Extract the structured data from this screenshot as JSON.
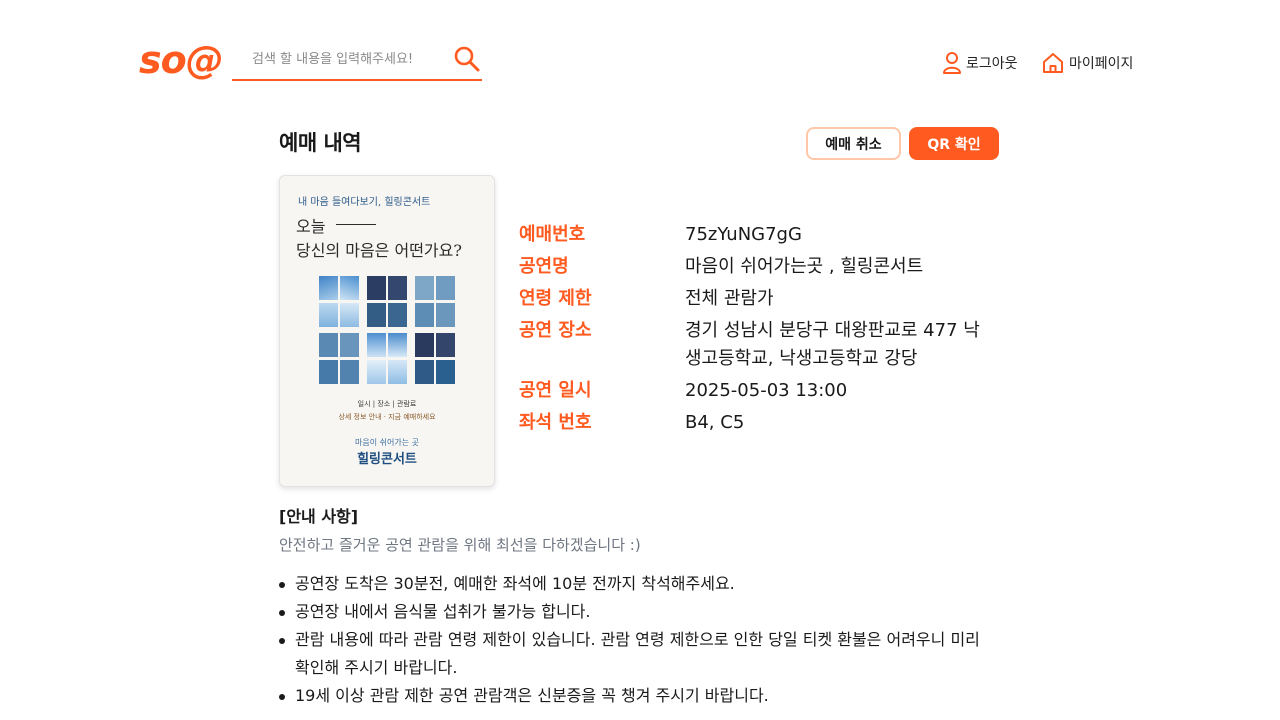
{
  "header": {
    "logo": "so@",
    "search_placeholder": "검색 할 내용을 입력해주세요!",
    "logout_label": "로그아웃",
    "mypage_label": "마이페이지"
  },
  "page": {
    "title": "예매 내역",
    "cancel_button": "예매 취소",
    "qr_button": "QR 확인"
  },
  "poster": {
    "small_line": "내 마음 들여다보기, 힐링콘서트",
    "line1": "오늘",
    "line2": "당신의 마음은 어떤가요?",
    "info1": "일시 | 장소 | 관람료",
    "info2": "상세 정보 안내 · 지금 예매하세요",
    "subtitle": "마음이 쉬어가는 곳",
    "name": "힐링콘서트"
  },
  "details": [
    {
      "label": "예매번호",
      "value": "75zYuNG7gG"
    },
    {
      "label": "공연명",
      "value": "마음이 쉬어가는곳 , 힐링콘서트"
    },
    {
      "label": "연령 제한",
      "value": "전체 관람가"
    },
    {
      "label": "공연 장소",
      "value": "경기 성남시 분당구 대왕판교로 477 낙생고등학교, 낙생고등학교 강당"
    },
    {
      "label": "공연 일시",
      "value": "2025-05-03 13:00"
    },
    {
      "label": "좌석 번호",
      "value": "B4, C5"
    }
  ],
  "notice": {
    "title": "[안내 사항]",
    "subtitle": "안전하고 즐거운 공연 관람을 위해 최선을 다하겠습니다 :)",
    "items": [
      "공연장 도착은 30분전, 예매한 좌석에 10분 전까지 착석해주세요.",
      "공연장 내에서 음식물 섭취가 불가능 합니다.",
      "관람 내용에 따라 관람 연령 제한이 있습니다. 관람 연령 제한으로 인한 당일 티켓 환불은 어려우니 미리 확인해 주시기 바랍니다.",
      "19세 이상 관람 제한 공연 관람객은 신분증을 꼭 챙겨 주시기 바랍니다."
    ]
  },
  "colors": {
    "accent": "#ff5a1f",
    "accent_light": "#ffc7a8",
    "muted": "#6f7782"
  },
  "icons": [
    "search-icon",
    "user-icon",
    "home-icon"
  ]
}
